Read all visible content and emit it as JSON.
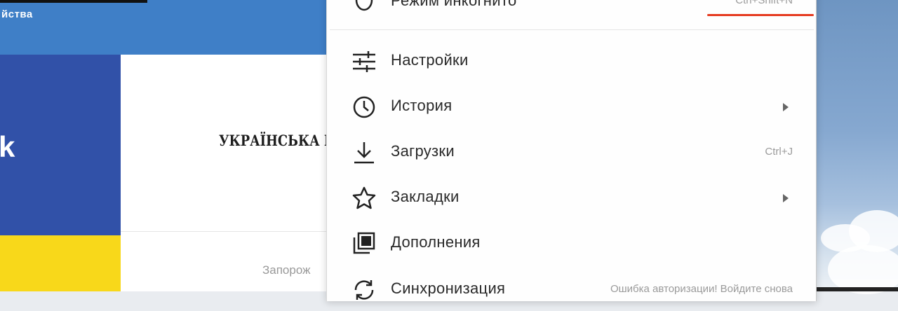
{
  "background_page": {
    "top_label": "йства",
    "flag_letter": "k",
    "card_heading": "УКРАЇНСЬКА І",
    "card_sub": "Запорож"
  },
  "menu": {
    "items": [
      {
        "label": "Режим инкогнито",
        "shortcut": "Ctrl+Shift+N",
        "icon": "incognito-icon"
      },
      {
        "label": "Настройки",
        "icon": "settings-sliders-icon"
      },
      {
        "label": "История",
        "icon": "clock-icon",
        "has_submenu": true
      },
      {
        "label": "Загрузки",
        "shortcut": "Ctrl+J",
        "icon": "download-icon"
      },
      {
        "label": "Закладки",
        "icon": "star-icon",
        "has_submenu": true
      },
      {
        "label": "Дополнения",
        "icon": "extensions-icon"
      },
      {
        "label": "Синхронизация",
        "shortcut": "Ошибка авторизации! Войдите снова",
        "icon": "sync-icon"
      }
    ]
  },
  "colors": {
    "accent_underline": "#e53a1f",
    "flag_blue": "#3151a8",
    "flag_yellow": "#f8d81a",
    "top_bar": "#3f7fc7"
  }
}
